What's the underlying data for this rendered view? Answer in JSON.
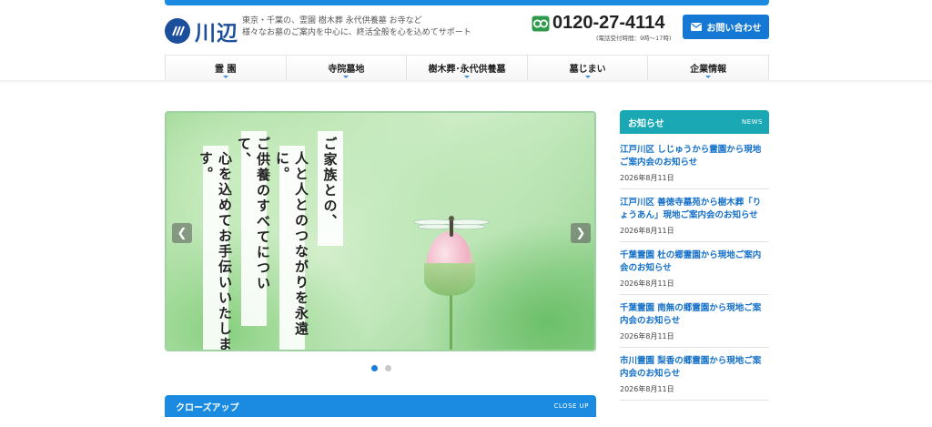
{
  "header": {
    "logo_text": "川辺",
    "logo_mark_icon": "kawabe-logo-icon",
    "tagline_line1": "東京・千葉の、霊園 樹木葬 永代供養墓 お寺など",
    "tagline_line2": "様々なお墓のご案内を中心に、終活全般を心を込めてサポート",
    "phone_icon": "free-dial-icon",
    "phone_number": "0120-27-4114",
    "phone_hours": "(電話受付時間：9時〜17時)",
    "contact_label": "お問い合わせ",
    "contact_icon": "mail-icon",
    "accent_color": "#1a8be0"
  },
  "nav": {
    "items": [
      {
        "label": "霊 園"
      },
      {
        "label": "寺院墓地"
      },
      {
        "label": "樹木葬･永代供養墓"
      },
      {
        "label": "墓じまい"
      },
      {
        "label": "企業情報"
      }
    ]
  },
  "hero": {
    "columns": [
      "ご家族との、",
      "人と人とのつながりを永遠に。",
      "ご供養のすべてについて、",
      "心を込めてお手伝いいたします。"
    ],
    "prev_icon": "chevron-left-icon",
    "next_icon": "chevron-right-icon",
    "slide_count": 2,
    "active_slide": 1
  },
  "closeup": {
    "title": "クローズアップ",
    "title_en": "CLOSE UP"
  },
  "news": {
    "title": "お知らせ",
    "title_en": "NEWS",
    "header_color": "#1aa9b4",
    "items": [
      {
        "title": "江戸川区 しじゅうから霊園から現地ご案内会のお知らせ",
        "date": "2026年8月11日"
      },
      {
        "title": "江戸川区 善徳寺墓苑から樹木葬「りょうあん」現地ご案内会のお知らせ",
        "date": "2026年8月11日"
      },
      {
        "title": "千葉霊園 杜の郷霊園から現地ご案内会のお知らせ",
        "date": "2026年8月11日"
      },
      {
        "title": "千葉霊園 南無の郷霊園から現地ご案内会のお知らせ",
        "date": "2026年8月11日"
      },
      {
        "title": "市川霊園 梨香の郷霊園から現地ご案内会のお知らせ",
        "date": "2026年8月11日"
      }
    ]
  }
}
